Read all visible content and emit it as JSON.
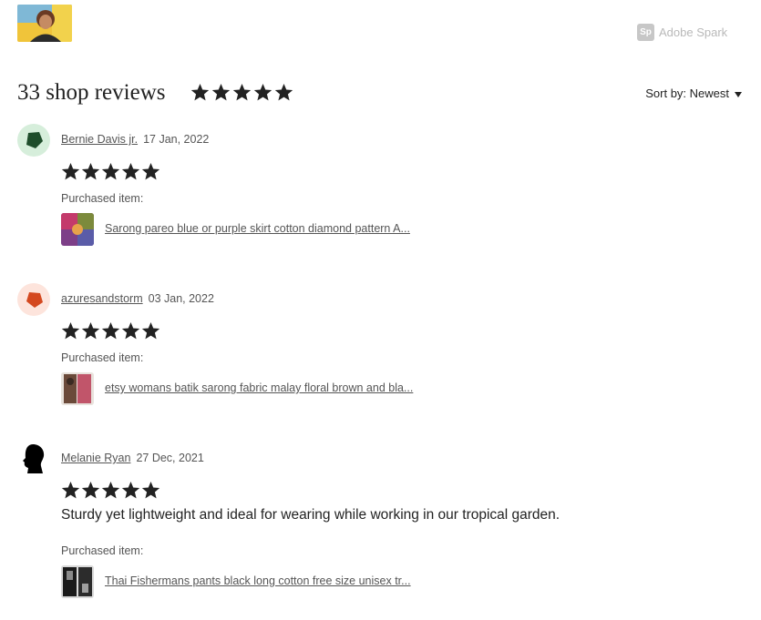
{
  "header": {
    "watermark": {
      "logo_text": "Sp",
      "label": "Adobe Spark"
    },
    "title": "33 shop reviews",
    "overall_rating": 5,
    "sort_label": "Sort by: Newest"
  },
  "reviews": [
    {
      "reviewer": "Bernie Davis jr.",
      "date": "17 Jan, 2022",
      "rating": 5,
      "text": "",
      "purchased_label": "Purchased item:",
      "item_title": "Sarong pareo blue or purple skirt cotton diamond pattern A...",
      "avatar_color": "#d6eedb",
      "avatar_shape_color": "#1e4d2b"
    },
    {
      "reviewer": "azuresandstorm",
      "date": "03 Jan, 2022",
      "rating": 5,
      "text": "",
      "purchased_label": "Purchased item:",
      "item_title": "etsy womans batik sarong fabric malay floral brown and bla...",
      "avatar_color": "#fde4dc",
      "avatar_shape_color": "#d4481f"
    },
    {
      "reviewer": "Melanie Ryan",
      "date": "27 Dec, 2021",
      "rating": 5,
      "text": "Sturdy yet lightweight and ideal for wearing while working in our tropical garden.",
      "purchased_label": "Purchased item:",
      "item_title": "Thai Fishermans pants black long cotton free size unisex tr...",
      "avatar_color": "#ffffff",
      "avatar_shape_color": "#000000"
    }
  ],
  "colors": {
    "star": "#222222",
    "muted_text": "#555555",
    "watermark": "#b9b9b9"
  }
}
